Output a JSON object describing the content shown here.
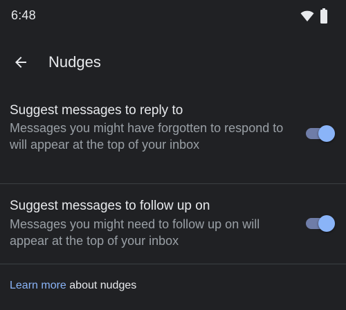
{
  "status_bar": {
    "time": "6:48",
    "icons": [
      "wifi-icon",
      "battery-icon"
    ]
  },
  "app_bar": {
    "back_icon": "arrow-back-icon",
    "title": "Nudges"
  },
  "settings": [
    {
      "title": "Suggest messages to reply to",
      "description": "Messages you might have forgotten to respond to will appear at the top of your inbox",
      "enabled": true
    },
    {
      "title": "Suggest messages to follow up on",
      "description": "Messages you might need to follow up on will appear at the top of your inbox",
      "enabled": true
    }
  ],
  "footer": {
    "link_text": "Learn more",
    "suffix_text": " about nudges"
  },
  "colors": {
    "background": "#202124",
    "primary_text": "#e8eaed",
    "secondary_text": "#9aa0a6",
    "accent": "#8ab4f8",
    "toggle_track": "#6f7da8",
    "divider": "#3c4043"
  }
}
